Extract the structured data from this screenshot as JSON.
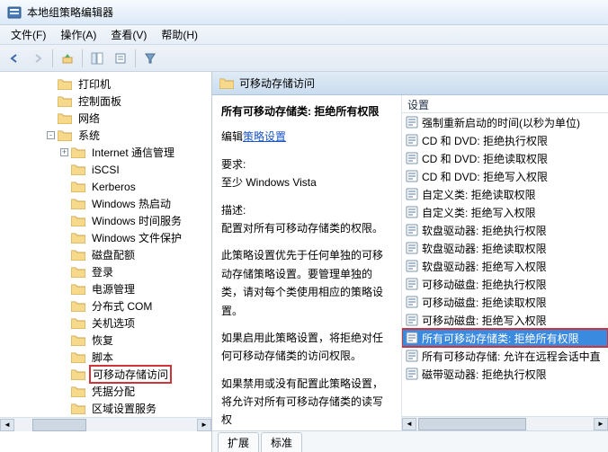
{
  "titlebar": {
    "title": "本地组策略编辑器"
  },
  "menubar": {
    "file": "文件(F)",
    "action": "操作(A)",
    "view": "查看(V)",
    "help": "帮助(H)"
  },
  "tree": {
    "items": [
      {
        "indent": 3,
        "twist": "",
        "label": "打印机"
      },
      {
        "indent": 3,
        "twist": "",
        "label": "控制面板"
      },
      {
        "indent": 3,
        "twist": "",
        "label": "网络"
      },
      {
        "indent": 3,
        "twist": "-",
        "label": "系统"
      },
      {
        "indent": 4,
        "twist": "+",
        "label": "Internet 通信管理"
      },
      {
        "indent": 4,
        "twist": "",
        "label": "iSCSI"
      },
      {
        "indent": 4,
        "twist": "",
        "label": "Kerberos"
      },
      {
        "indent": 4,
        "twist": "",
        "label": "Windows 热启动"
      },
      {
        "indent": 4,
        "twist": "",
        "label": "Windows 时间服务"
      },
      {
        "indent": 4,
        "twist": "",
        "label": "Windows 文件保护"
      },
      {
        "indent": 4,
        "twist": "",
        "label": "磁盘配额"
      },
      {
        "indent": 4,
        "twist": "",
        "label": "登录"
      },
      {
        "indent": 4,
        "twist": "",
        "label": "电源管理"
      },
      {
        "indent": 4,
        "twist": "",
        "label": "分布式 COM"
      },
      {
        "indent": 4,
        "twist": "",
        "label": "关机选项"
      },
      {
        "indent": 4,
        "twist": "",
        "label": "恢复"
      },
      {
        "indent": 4,
        "twist": "",
        "label": "脚本"
      },
      {
        "indent": 4,
        "twist": "",
        "label": "可移动存储访问",
        "selected": true
      },
      {
        "indent": 4,
        "twist": "",
        "label": "凭据分配"
      },
      {
        "indent": 4,
        "twist": "",
        "label": "区域设置服务"
      }
    ]
  },
  "category": {
    "title": "可移动存储访问"
  },
  "detail": {
    "title": "所有可移动存储类: 拒绝所有权限",
    "edit_label": "编辑",
    "edit_link": "策略设置",
    "req_label": "要求:",
    "req_value": "至少 Windows Vista",
    "desc_label": "描述:",
    "desc1": "配置对所有可移动存储类的权限。",
    "desc2": "此策略设置优先于任何单独的可移动存储策略设置。要管理单独的类，请对每个类使用相应的策略设置。",
    "desc3": "如果启用此策略设置，将拒绝对任何可移动存储类的访问权限。",
    "desc4": "如果禁用或没有配置此策略设置，将允许对所有可移动存储类的读写权"
  },
  "settings": {
    "header": "设置",
    "items": [
      "强制重新启动的时间(以秒为单位)",
      "CD 和 DVD: 拒绝执行权限",
      "CD 和 DVD: 拒绝读取权限",
      "CD 和 DVD: 拒绝写入权限",
      "自定义类: 拒绝读取权限",
      "自定义类: 拒绝写入权限",
      "软盘驱动器: 拒绝执行权限",
      "软盘驱动器: 拒绝读取权限",
      "软盘驱动器: 拒绝写入权限",
      "可移动磁盘: 拒绝执行权限",
      "可移动磁盘: 拒绝读取权限",
      "可移动磁盘: 拒绝写入权限",
      "所有可移动存储类: 拒绝所有权限",
      "所有可移动存储: 允许在远程会话中直",
      "磁带驱动器: 拒绝执行权限"
    ],
    "highlighted_index": 12
  },
  "tabs": {
    "extended": "扩展",
    "standard": "标准"
  }
}
